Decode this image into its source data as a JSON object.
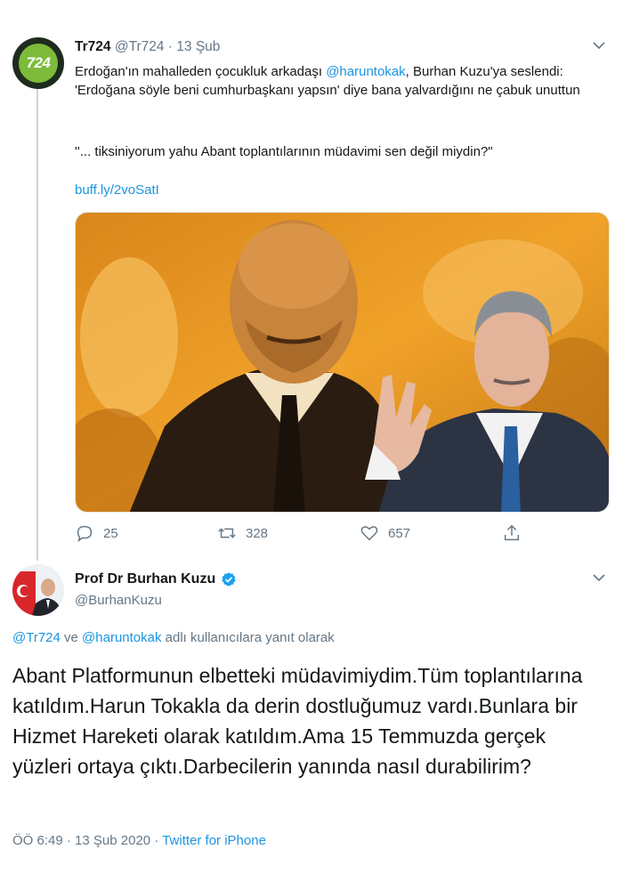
{
  "tweet1": {
    "avatar_text": "724",
    "name": "Tr724",
    "handle": "@Tr724",
    "separator": "·",
    "date": "13 Şub",
    "text_prefix": "Erdoğan'ın mahalleden çocukluk arkadaşı ",
    "mention": "@haruntokak",
    "text_suffix": ", Burhan Kuzu'ya seslendi: 'Erdoğana söyle beni cumhurbaşkanı yapsın' diye bana yalvardığını ne çabuk unuttun",
    "quote": "''... tiksiniyorum yahu Abant toplantılarının müdavimi sen değil miydin?\"",
    "url": "buff.ly/2voSatI",
    "replies": "25",
    "retweets": "328",
    "likes": "657"
  },
  "tweet2": {
    "name": "Prof Dr Burhan Kuzu",
    "handle": "@BurhanKuzu",
    "reply_mention1": "@Tr724",
    "reply_and": " ve ",
    "reply_mention2": "@haruntokak",
    "reply_suffix": " adlı kullanıcılara yanıt olarak",
    "text": "Abant Platformunun elbetteki müdavimiydim.Tüm toplantılarına katıldım.Harun Tokakla da derin dostluğumuz vardı.Bunlara bir Hizmet Hareketi olarak katıldım.Ama 15 Temmuzda gerçek yüzleri ortaya çıktı.Darbecilerin yanında nasıl durabilirim?",
    "time": "ÖÖ 6:49",
    "separator1": " · ",
    "date": "13 Şub 2020",
    "separator2": " · ",
    "source": "Twitter for iPhone"
  },
  "icons": {
    "caret": "chevron-down-icon",
    "reply": "reply-icon",
    "retweet": "retweet-icon",
    "like": "heart-icon",
    "share": "share-icon",
    "verified": "verified-badge-icon"
  },
  "colors": {
    "link": "#1b95e0",
    "muted": "#657786",
    "text": "#14171a",
    "verified": "#1da1f2",
    "brand_green": "#7dbb3a",
    "photo_orange": "#f2a32a"
  }
}
